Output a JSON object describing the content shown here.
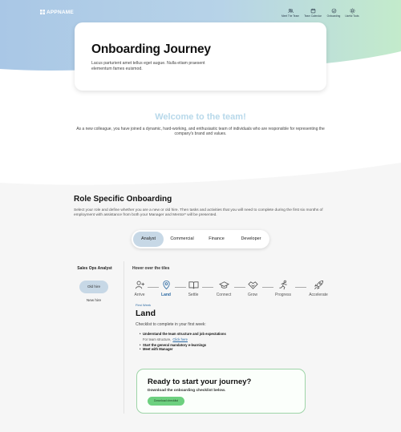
{
  "header": {
    "logo_text": "APPNAME",
    "nav": [
      {
        "label": "Meet The Team",
        "icon": "team-icon"
      },
      {
        "label": "Team Calendar",
        "icon": "calendar-icon"
      },
      {
        "label": "Onboarding",
        "icon": "onboarding-icon"
      },
      {
        "label": "Useful Tools",
        "icon": "tools-icon"
      }
    ]
  },
  "hero": {
    "title": "Onboarding Journey",
    "description": "Lacus parturient amet tellus eget augue. Nulla etiam praesent elementum fames euismod."
  },
  "welcome": {
    "title": "Welcome to the team!",
    "text": "As a new colleague, you have joined a dynamic, hard-working, and enthusiastic team of individuals who are responsible for representing the company's brand and values."
  },
  "role_section": {
    "title": "Role Specific Onboarding",
    "description": "Select your role and define whether you are a new or old hire. Then tasks and activities that you will need to complete during the first six months of employment with assistance from both your Manager and Mentor* will be presented.",
    "tabs": [
      "Analyst",
      "Commercial",
      "Finance",
      "Developer"
    ],
    "active_tab": "Analyst"
  },
  "sidebar": {
    "title": "Sales Ops Analyst",
    "options": [
      "Old hire",
      "New hire"
    ],
    "selected": "Old hire"
  },
  "journey": {
    "hint": "Hover over the tiles",
    "stages": [
      {
        "label": "Arrive",
        "icon": "add-user-icon"
      },
      {
        "label": "Land",
        "icon": "location-pin-icon"
      },
      {
        "label": "Settle",
        "icon": "book-icon"
      },
      {
        "label": "Connect",
        "icon": "graduation-cap-icon"
      },
      {
        "label": "Grow",
        "icon": "handshake-icon"
      },
      {
        "label": "Progress",
        "icon": "runner-icon"
      },
      {
        "label": "Accelerate",
        "icon": "rocket-icon"
      }
    ],
    "active_stage": "Land"
  },
  "phase": {
    "subtitle": "First Week",
    "title": "Land",
    "intro": "Checklist to complete in your first week:",
    "items": [
      {
        "text": "Understand the team structure and job expectations",
        "sub_text": "For team structure,",
        "sub_link": "Click here"
      },
      {
        "text": "Start the general mandatory e-learnings"
      },
      {
        "text": "Meet with Manager"
      }
    ]
  },
  "cta": {
    "title": "Ready to start your journey?",
    "subtitle": "Download the onboarding checklist below.",
    "button": "Download checklist"
  },
  "colors": {
    "hero_blue": "#a9c7e6",
    "hero_green": "#bfe8c9",
    "active_pill": "#c7d8e6",
    "accent_blue": "#2c6aa3",
    "cta_green": "#6dd07f",
    "welcome_title": "#b7d8ea"
  }
}
